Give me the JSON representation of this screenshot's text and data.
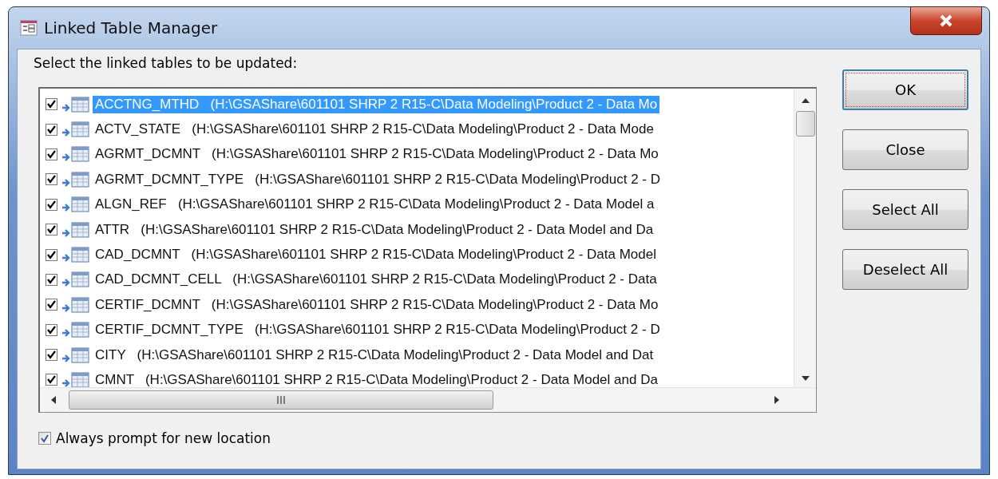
{
  "window": {
    "title": "Linked Table Manager"
  },
  "prompt": "Select the linked tables to be updated:",
  "tables": [
    {
      "checked": true,
      "selected": true,
      "text": "ACCTNG_MTHD   (H:\\GSAShare\\601101 SHRP 2 R15-C\\Data Modeling\\Product 2 - Data Mo"
    },
    {
      "checked": true,
      "selected": false,
      "text": "ACTV_STATE   (H:\\GSAShare\\601101 SHRP 2 R15-C\\Data Modeling\\Product 2 - Data Mode"
    },
    {
      "checked": true,
      "selected": false,
      "text": "AGRMT_DCMNT   (H:\\GSAShare\\601101 SHRP 2 R15-C\\Data Modeling\\Product 2 - Data Mo"
    },
    {
      "checked": true,
      "selected": false,
      "text": "AGRMT_DCMNT_TYPE   (H:\\GSAShare\\601101 SHRP 2 R15-C\\Data Modeling\\Product 2 - D"
    },
    {
      "checked": true,
      "selected": false,
      "text": "ALGN_REF   (H:\\GSAShare\\601101 SHRP 2 R15-C\\Data Modeling\\Product 2 - Data Model a"
    },
    {
      "checked": true,
      "selected": false,
      "text": "ATTR   (H:\\GSAShare\\601101 SHRP 2 R15-C\\Data Modeling\\Product 2 - Data Model and Da"
    },
    {
      "checked": true,
      "selected": false,
      "text": "CAD_DCMNT   (H:\\GSAShare\\601101 SHRP 2 R15-C\\Data Modeling\\Product 2 - Data Model"
    },
    {
      "checked": true,
      "selected": false,
      "text": "CAD_DCMNT_CELL   (H:\\GSAShare\\601101 SHRP 2 R15-C\\Data Modeling\\Product 2 - Data"
    },
    {
      "checked": true,
      "selected": false,
      "text": "CERTIF_DCMNT   (H:\\GSAShare\\601101 SHRP 2 R15-C\\Data Modeling\\Product 2 - Data Mo"
    },
    {
      "checked": true,
      "selected": false,
      "text": "CERTIF_DCMNT_TYPE   (H:\\GSAShare\\601101 SHRP 2 R15-C\\Data Modeling\\Product 2 - D"
    },
    {
      "checked": true,
      "selected": false,
      "text": "CITY   (H:\\GSAShare\\601101 SHRP 2 R15-C\\Data Modeling\\Product 2 - Data Model and Dat"
    },
    {
      "checked": true,
      "selected": false,
      "text": "CMNT   (H:\\GSAShare\\601101 SHRP 2 R15-C\\Data Modeling\\Product 2 - Data Model and Da"
    }
  ],
  "buttons": [
    {
      "label": "OK",
      "default": true
    },
    {
      "label": "Close",
      "default": false
    },
    {
      "label": "Select All",
      "default": false
    },
    {
      "label": "Deselect All",
      "default": false
    }
  ],
  "always_prompt": {
    "label": "Always prompt for new location",
    "checked": true
  }
}
